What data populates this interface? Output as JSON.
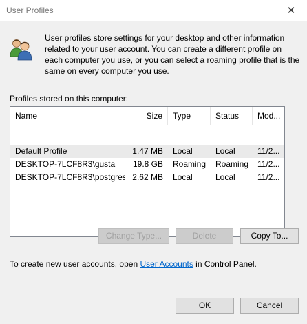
{
  "window": {
    "title": "User Profiles",
    "close_symbol": "✕"
  },
  "intro": {
    "icon": "users-icon",
    "text": "User profiles store settings for your desktop and other information related to your user account. You can create a different profile on each computer you use, or you can select a roaming profile that is the same on every computer you use."
  },
  "profiles": {
    "label": "Profiles stored on this computer:",
    "columns": [
      "Name",
      "Size",
      "Type",
      "Status",
      "Mod..."
    ],
    "rows": [
      {
        "name": "Default Profile",
        "size": "1.47 MB",
        "type": "Local",
        "status": "Local",
        "modified": "11/2..."
      },
      {
        "name": "DESKTOP-7LCF8R3\\gusta",
        "size": "19.8 GB",
        "type": "Roaming",
        "status": "Roaming",
        "modified": "11/2..."
      },
      {
        "name": "DESKTOP-7LCF8R3\\postgres",
        "size": "2.62 MB",
        "type": "Local",
        "status": "Local",
        "modified": "11/2..."
      }
    ]
  },
  "buttons": {
    "change_type": "Change Type...",
    "delete": "Delete",
    "copy_to": "Copy To...",
    "ok": "OK",
    "cancel": "Cancel"
  },
  "footer": {
    "prefix": "To create new user accounts, open ",
    "link": "User Accounts",
    "suffix": " in Control Panel."
  },
  "colors": {
    "link": "#0066cc",
    "selection": "#eaeaea",
    "disabled_text": "#a0a0a0"
  }
}
